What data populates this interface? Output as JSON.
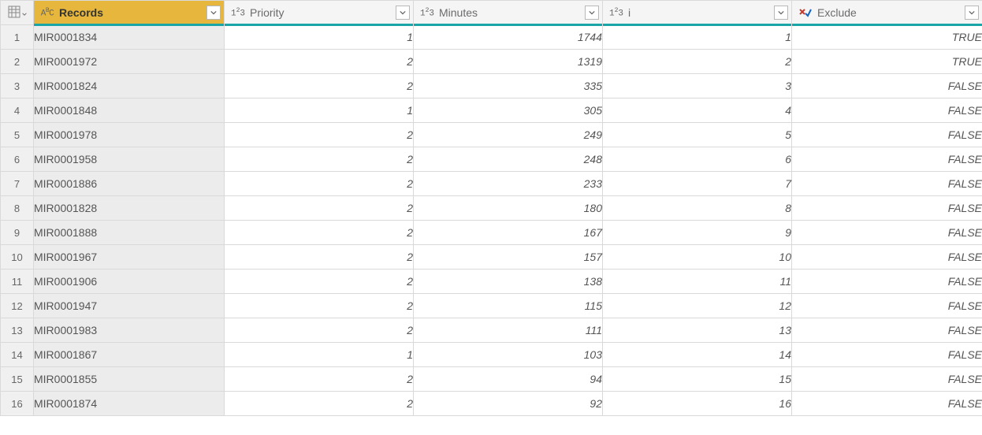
{
  "columns": {
    "records": {
      "label": "Records",
      "type": "text"
    },
    "priority": {
      "label": "Priority",
      "type": "number"
    },
    "minutes": {
      "label": " Minutes",
      "type": "number"
    },
    "i": {
      "label": "i",
      "type": "number"
    },
    "exclude": {
      "label": "Exclude",
      "type": "bool"
    }
  },
  "rows": [
    {
      "n": "1",
      "records": "MIR0001834",
      "priority": "1",
      "minutes": "1744",
      "i": "1",
      "exclude": "TRUE"
    },
    {
      "n": "2",
      "records": "MIR0001972",
      "priority": "2",
      "minutes": "1319",
      "i": "2",
      "exclude": "TRUE"
    },
    {
      "n": "3",
      "records": "MIR0001824",
      "priority": "2",
      "minutes": "335",
      "i": "3",
      "exclude": "FALSE"
    },
    {
      "n": "4",
      "records": "MIR0001848",
      "priority": "1",
      "minutes": "305",
      "i": "4",
      "exclude": "FALSE"
    },
    {
      "n": "5",
      "records": "MIR0001978",
      "priority": "2",
      "minutes": "249",
      "i": "5",
      "exclude": "FALSE"
    },
    {
      "n": "6",
      "records": "MIR0001958",
      "priority": "2",
      "minutes": "248",
      "i": "6",
      "exclude": "FALSE"
    },
    {
      "n": "7",
      "records": "MIR0001886",
      "priority": "2",
      "minutes": "233",
      "i": "7",
      "exclude": "FALSE"
    },
    {
      "n": "8",
      "records": "MIR0001828",
      "priority": "2",
      "minutes": "180",
      "i": "8",
      "exclude": "FALSE"
    },
    {
      "n": "9",
      "records": "MIR0001888",
      "priority": "2",
      "minutes": "167",
      "i": "9",
      "exclude": "FALSE"
    },
    {
      "n": "10",
      "records": "MIR0001967",
      "priority": "2",
      "minutes": "157",
      "i": "10",
      "exclude": "FALSE"
    },
    {
      "n": "11",
      "records": "MIR0001906",
      "priority": "2",
      "minutes": "138",
      "i": "11",
      "exclude": "FALSE"
    },
    {
      "n": "12",
      "records": "MIR0001947",
      "priority": "2",
      "minutes": "115",
      "i": "12",
      "exclude": "FALSE"
    },
    {
      "n": "13",
      "records": "MIR0001983",
      "priority": "2",
      "minutes": "111",
      "i": "13",
      "exclude": "FALSE"
    },
    {
      "n": "14",
      "records": "MIR0001867",
      "priority": "1",
      "minutes": "103",
      "i": "14",
      "exclude": "FALSE"
    },
    {
      "n": "15",
      "records": "MIR0001855",
      "priority": "2",
      "minutes": "94",
      "i": "15",
      "exclude": "FALSE"
    },
    {
      "n": "16",
      "records": "MIR0001874",
      "priority": "2",
      "minutes": "92",
      "i": "16",
      "exclude": "FALSE"
    }
  ]
}
